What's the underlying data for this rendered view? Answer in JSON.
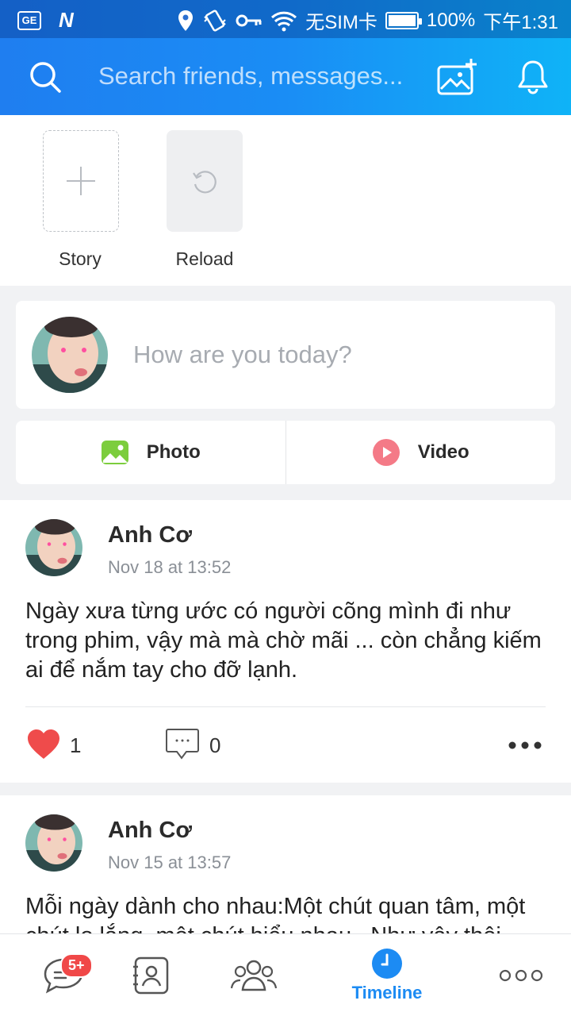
{
  "status_bar": {
    "left_icons": [
      "ge-icon",
      "n-icon"
    ],
    "ge_label": "GE",
    "n_label": "N",
    "carrier": "无SIM卡",
    "battery": "100%",
    "time": "下午1:31"
  },
  "header": {
    "search_placeholder": "Search friends, messages..."
  },
  "stories": {
    "items": [
      {
        "label": "Story"
      },
      {
        "label": "Reload"
      }
    ]
  },
  "composer": {
    "placeholder": "How are you today?",
    "photo_label": "Photo",
    "video_label": "Video"
  },
  "posts": [
    {
      "author": "Anh Cơ",
      "time": "Nov 18 at 13:52",
      "body": "Ngày xưa từng ước có người cõng mình đi như trong phim, vậy mà mà chờ mãi ... còn chẳng kiếm ai để nắm tay cho đỡ lạnh.",
      "likes": "1",
      "comments": "0"
    },
    {
      "author": "Anh Cơ",
      "time": "Nov 15 at 13:57",
      "body": "Mỗi ngày dành cho nhau:Một chút quan tâm, một chút lo lắng, một chút hiểu nhau...Như vậy thôi"
    }
  ],
  "bottom_nav": {
    "messages_badge": "5+",
    "active_label": "Timeline"
  },
  "colors": {
    "accent": "#1c8bf3",
    "like": "#ef4b4b",
    "badge": "#f04848"
  }
}
